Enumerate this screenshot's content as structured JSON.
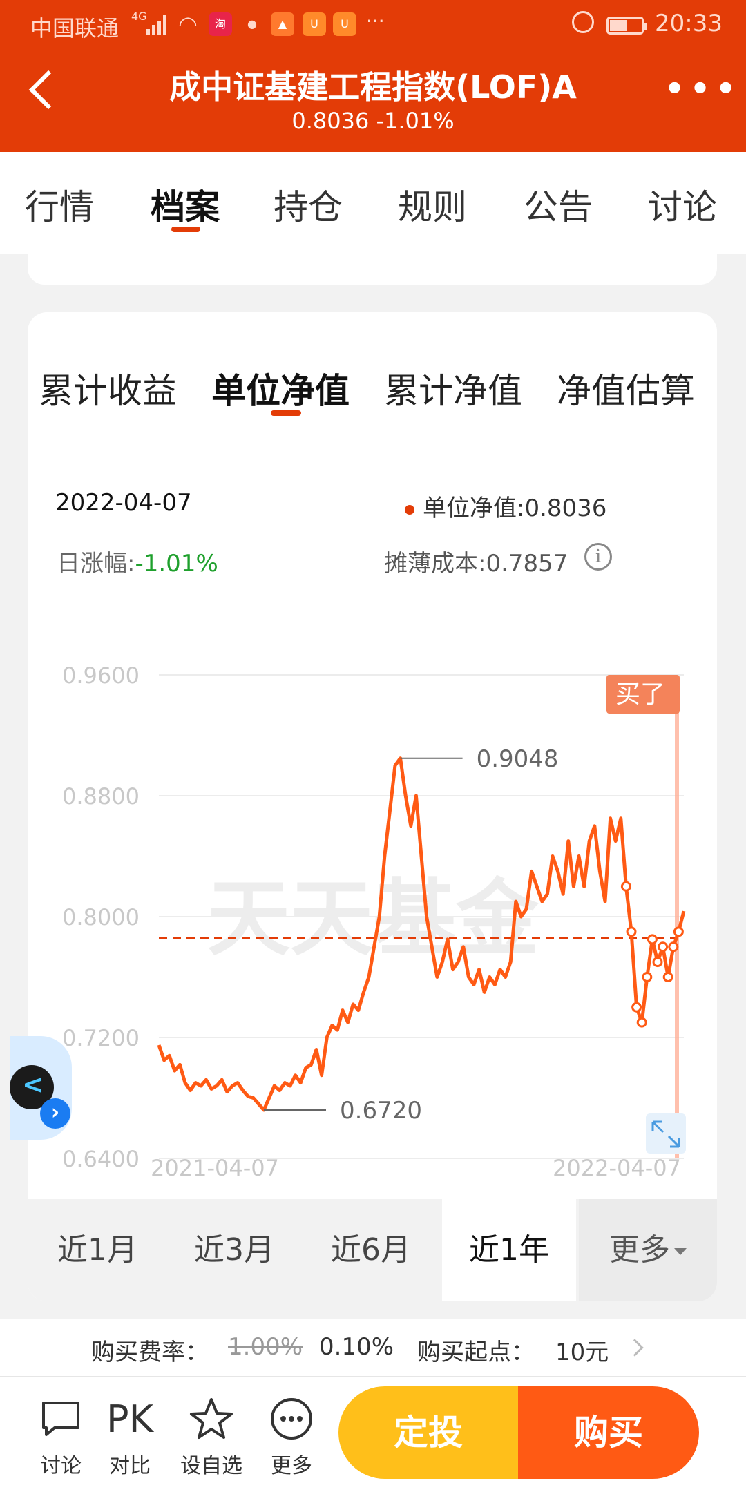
{
  "status_bar": {
    "carrier": "中国联通",
    "network": "4G",
    "time": "20:33",
    "more": "···"
  },
  "header": {
    "title": "成中证基建工程指数(LOF)A",
    "subtitle": "0.8036 -1.01%"
  },
  "tabs": [
    {
      "label": "行情",
      "active": false
    },
    {
      "label": "档案",
      "active": true
    },
    {
      "label": "持仓",
      "active": false
    },
    {
      "label": "规则",
      "active": false
    },
    {
      "label": "公告",
      "active": false
    },
    {
      "label": "讨论",
      "active": false
    }
  ],
  "subtabs": [
    {
      "label": "累计收益",
      "active": false
    },
    {
      "label": "单位净值",
      "active": true
    },
    {
      "label": "累计净值",
      "active": false
    },
    {
      "label": "净值估算",
      "active": false
    }
  ],
  "info": {
    "date": "2022-04-07",
    "nav_label": "单位净值:",
    "nav_value": "0.8036",
    "change_label": "日涨幅:",
    "change_value": "-1.01%",
    "cost_label": "摊薄成本:",
    "cost_value": "0.7857",
    "info_icon": "info-icon"
  },
  "chart_data": {
    "type": "line",
    "watermark": "天天基金",
    "x_start_label": "2021-04-07",
    "x_end_label": "2022-04-07",
    "y_ticks": [
      "0.9600",
      "0.8800",
      "0.8000",
      "0.7200",
      "0.6400"
    ],
    "ylim": [
      0.64,
      0.96
    ],
    "max_label": "0.9048",
    "min_label": "0.6720",
    "reference_line": 0.7857,
    "buy_tag": "买了",
    "series": [
      {
        "values": [
          0.715,
          0.705,
          0.708,
          0.698,
          0.702,
          0.69,
          0.685,
          0.69,
          0.688,
          0.692,
          0.686,
          0.688,
          0.692,
          0.684,
          0.688,
          0.69,
          0.685,
          0.681,
          0.68,
          0.676,
          0.672,
          0.68,
          0.688,
          0.685,
          0.69,
          0.688,
          0.695,
          0.69,
          0.7,
          0.702,
          0.712,
          0.695,
          0.72,
          0.728,
          0.725,
          0.738,
          0.73,
          0.742,
          0.738,
          0.75,
          0.76,
          0.78,
          0.8,
          0.84,
          0.87,
          0.9,
          0.9048,
          0.88,
          0.86,
          0.88,
          0.84,
          0.8,
          0.78,
          0.76,
          0.77,
          0.785,
          0.765,
          0.77,
          0.78,
          0.76,
          0.755,
          0.765,
          0.75,
          0.76,
          0.755,
          0.765,
          0.76,
          0.77,
          0.81,
          0.8,
          0.805,
          0.83,
          0.82,
          0.81,
          0.815,
          0.84,
          0.83,
          0.815,
          0.85,
          0.82,
          0.84,
          0.82,
          0.85,
          0.86,
          0.83,
          0.81,
          0.865,
          0.85,
          0.865,
          0.82,
          0.79,
          0.74,
          0.73,
          0.76,
          0.785,
          0.77,
          0.78,
          0.76,
          0.78,
          0.79,
          0.8036
        ]
      }
    ],
    "markers_start_index": 89
  },
  "periods": [
    {
      "label": "近1月",
      "active": false
    },
    {
      "label": "近3月",
      "active": false
    },
    {
      "label": "近6月",
      "active": false
    },
    {
      "label": "近1年",
      "active": true
    }
  ],
  "period_more": "更多",
  "fee": {
    "rate_label": "购买费率：",
    "rate_old": "1.00%",
    "rate_new": "0.10%",
    "min_label": "购买起点：",
    "min_value": "10元"
  },
  "bottom_bar": {
    "items": [
      {
        "label": "讨论",
        "icon": "comment-icon"
      },
      {
        "label": "对比",
        "icon": "pk-icon",
        "icon_text": "PK"
      },
      {
        "label": "设自选",
        "icon": "star-icon"
      },
      {
        "label": "更多",
        "icon": "more-icon"
      }
    ],
    "dingtou_label": "定投",
    "buy_label": "购买"
  },
  "colors": {
    "brand": "#e33c07",
    "line": "#ff5a14",
    "up_green": "#1fa02d",
    "button_yellow": "#ffbf1a",
    "button_orange": "#ff5a14"
  }
}
